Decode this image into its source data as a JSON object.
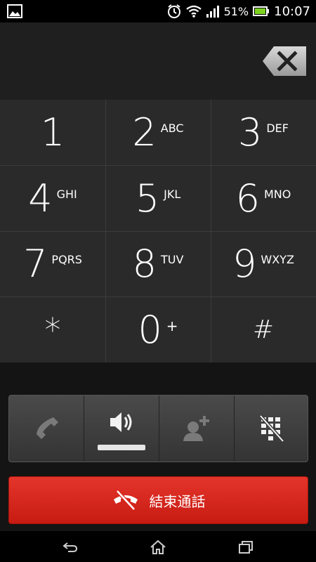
{
  "status_bar": {
    "battery_percent": "51%",
    "time": "10:07",
    "icons": [
      "gallery-icon",
      "alarm-icon",
      "wifi-icon",
      "signal-icon",
      "battery-icon"
    ]
  },
  "keypad": [
    {
      "digit": "1",
      "letters": ""
    },
    {
      "digit": "2",
      "letters": "ABC"
    },
    {
      "digit": "3",
      "letters": "DEF"
    },
    {
      "digit": "4",
      "letters": "GHI"
    },
    {
      "digit": "5",
      "letters": "JKL"
    },
    {
      "digit": "6",
      "letters": "MNO"
    },
    {
      "digit": "7",
      "letters": "PQRS"
    },
    {
      "digit": "8",
      "letters": "TUV"
    },
    {
      "digit": "9",
      "letters": "WXYZ"
    },
    {
      "digit": "*",
      "letters": ""
    },
    {
      "digit": "0",
      "letters": "+"
    },
    {
      "digit": "#",
      "letters": ""
    }
  ],
  "actions": [
    {
      "name": "handset",
      "icon": "handset-icon",
      "active": false
    },
    {
      "name": "speaker",
      "icon": "speaker-icon",
      "active": true
    },
    {
      "name": "add-call",
      "icon": "add-contact-icon",
      "active": false
    },
    {
      "name": "dialpad",
      "icon": "dialpad-hide-icon",
      "active": false
    }
  ],
  "end_call": {
    "label": "結束通話",
    "color": "#d9261c"
  },
  "colors": {
    "keypad_bg": "#2a2a2a",
    "display_bg": "#1f1f1f",
    "accent": "#d9261c"
  }
}
